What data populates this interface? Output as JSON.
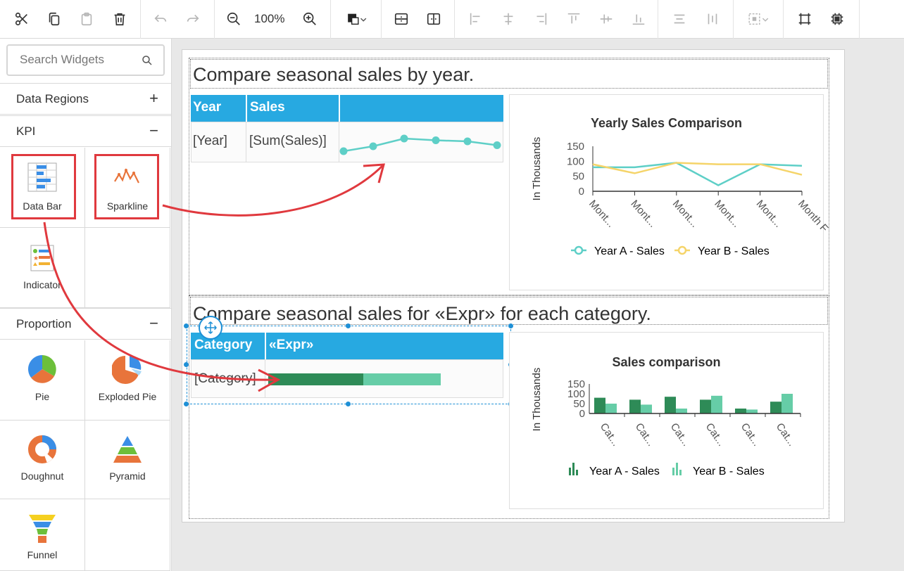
{
  "toolbar": {
    "zoom": "100%",
    "buttons": [
      "cut-icon",
      "copy-icon",
      "paste-icon",
      "delete-icon",
      "undo-icon",
      "redo-icon",
      "zoom-out-icon",
      "zoom-in-icon",
      "fill-color-icon",
      "insert-row-icon",
      "insert-column-icon",
      "align-left-icon",
      "align-center-icon",
      "align-right-icon",
      "align-top-icon",
      "align-middle-icon",
      "align-bottom-icon",
      "distribute-horizontal-icon",
      "distribute-vertical-icon",
      "group-icon",
      "fit-to-page-icon",
      "fit-to-width-icon"
    ]
  },
  "sidebar": {
    "search_placeholder": "Search Widgets",
    "sections": {
      "data_regions": "Data Regions",
      "kpi": "KPI",
      "proportion": "Proportion"
    },
    "kpi_items": [
      "Data Bar",
      "Sparkline",
      "Indicator"
    ],
    "proportion_items": [
      "Pie",
      "Exploded Pie",
      "Doughnut",
      "Pyramid",
      "Funnel"
    ]
  },
  "report": {
    "section1": {
      "title": "Compare seasonal sales by year.",
      "headers": [
        "Year",
        "Sales",
        ""
      ],
      "row": [
        "[Year]",
        "[Sum(Sales)]"
      ],
      "sparkline_values": [
        0.62,
        0.48,
        0.26,
        0.31,
        0.34,
        0.45
      ]
    },
    "chart1": {
      "title": "Yearly Sales Comparison",
      "ylabel": "In Thousands",
      "yticks": [
        "150",
        "100",
        "50",
        "0"
      ],
      "xticks": [
        "Mont...",
        "Mont...",
        "Mont...",
        "Mont...",
        "Mont...",
        "Month F"
      ],
      "legend": [
        "Year A - Sales",
        "Year B - Sales"
      ]
    },
    "section2": {
      "title": "Compare seasonal sales for «Expr» for each category.",
      "headers": [
        "Category",
        "«Expr»"
      ],
      "row": [
        "[Category]"
      ],
      "databar": [
        55,
        45
      ]
    },
    "chart2": {
      "title": "Sales comparison",
      "ylabel": "In Thousands",
      "yticks": [
        "150",
        "100",
        "50",
        "0"
      ],
      "xticks": [
        "Cat...",
        "Cat...",
        "Cat...",
        "Cat...",
        "Cat...",
        "Cat..."
      ],
      "legend": [
        "Year A - Sales",
        "Year B - Sales"
      ]
    }
  },
  "colors": {
    "accent": "#27a9e1",
    "series_teal": "#5ecfc7",
    "series_yellow": "#f5d469",
    "bar_dark": "#2e8b57",
    "bar_light": "#66cda7",
    "annotation": "#e0393e"
  },
  "chart_data": [
    {
      "type": "line",
      "title": "Yearly Sales Comparison",
      "ylabel": "In Thousands",
      "ylim": [
        0,
        150
      ],
      "categories": [
        "Mont...",
        "Mont...",
        "Mont...",
        "Mont...",
        "Mont...",
        "Month F"
      ],
      "series": [
        {
          "name": "Year A - Sales",
          "values": [
            80,
            80,
            95,
            20,
            90,
            85
          ]
        },
        {
          "name": "Year B - Sales",
          "values": [
            90,
            60,
            95,
            90,
            90,
            55
          ]
        }
      ],
      "legend": "bottom"
    },
    {
      "type": "bar",
      "title": "Sales comparison",
      "ylabel": "In Thousands",
      "ylim": [
        0,
        150
      ],
      "categories": [
        "Cat...",
        "Cat...",
        "Cat...",
        "Cat...",
        "Cat...",
        "Cat..."
      ],
      "series": [
        {
          "name": "Year A - Sales",
          "values": [
            80,
            70,
            85,
            70,
            25,
            60
          ]
        },
        {
          "name": "Year B - Sales",
          "values": [
            50,
            45,
            25,
            90,
            20,
            100
          ]
        }
      ],
      "legend": "bottom"
    }
  ]
}
